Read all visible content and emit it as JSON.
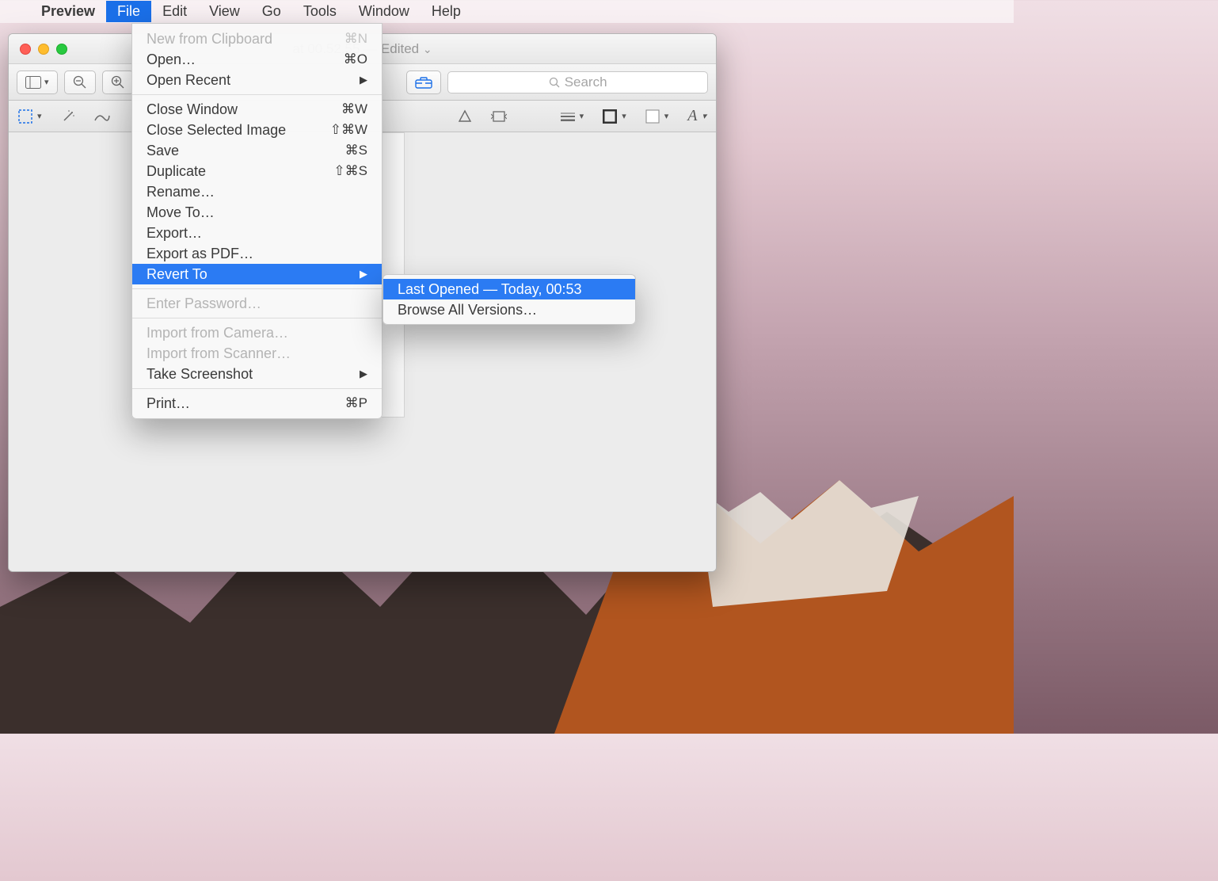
{
  "menubar": {
    "appname": "Preview",
    "items": [
      "File",
      "Edit",
      "View",
      "Go",
      "Tools",
      "Window",
      "Help"
    ],
    "active_index": 0
  },
  "window": {
    "title_fragment": "at 00.52.55",
    "edited_label": "— Edited",
    "search_placeholder": "Search"
  },
  "file_menu": {
    "groups": [
      [
        {
          "label": "New from Clipboard",
          "shortcut": "⌘N",
          "disabled": true
        },
        {
          "label": "Open…",
          "shortcut": "⌘O"
        },
        {
          "label": "Open Recent",
          "submenu": true
        }
      ],
      [
        {
          "label": "Close Window",
          "shortcut": "⌘W"
        },
        {
          "label": "Close Selected Image",
          "shortcut": "⇧⌘W"
        },
        {
          "label": "Save",
          "shortcut": "⌘S"
        },
        {
          "label": "Duplicate",
          "shortcut": "⇧⌘S"
        },
        {
          "label": "Rename…"
        },
        {
          "label": "Move To…"
        },
        {
          "label": "Export…"
        },
        {
          "label": "Export as PDF…"
        },
        {
          "label": "Revert To",
          "submenu": true,
          "highlighted": true
        }
      ],
      [
        {
          "label": "Enter Password…",
          "disabled": true
        }
      ],
      [
        {
          "label": "Import from Camera…",
          "disabled": true
        },
        {
          "label": "Import from Scanner…",
          "disabled": true
        },
        {
          "label": "Take Screenshot",
          "submenu": true
        }
      ],
      [
        {
          "label": "Print…",
          "shortcut": "⌘P"
        }
      ]
    ]
  },
  "revert_submenu": {
    "items": [
      {
        "label": "Last Opened — Today, 00:53",
        "highlighted": true
      },
      {
        "label": "Browse All Versions…"
      }
    ]
  }
}
